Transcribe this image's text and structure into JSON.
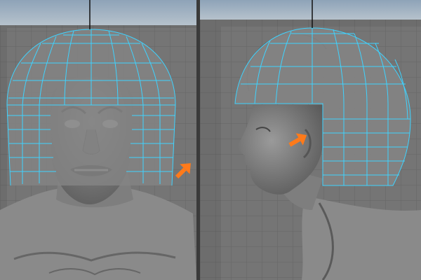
{
  "colors": {
    "sky_top": "#8ea3b8",
    "sky_bottom": "#b6c2cc",
    "viewport_bg": "#6d6d6d",
    "ortho_plane": "#7b7b7b",
    "grid_line": "#5a5a5a",
    "wireframe": "#3fd3ff",
    "wire_fill": "#848484",
    "model_gray": "#8a8a8a",
    "arrow_orange": "#ff7a1a",
    "divider": "#3a3a3a",
    "pivot_line": "#111111"
  },
  "viewports": [
    {
      "id": "front",
      "view": "front-orthographic",
      "annotation_arrow": "orange-arrow-icon"
    },
    {
      "id": "side",
      "view": "side-orthographic",
      "annotation_arrow": "orange-arrow-icon"
    }
  ]
}
